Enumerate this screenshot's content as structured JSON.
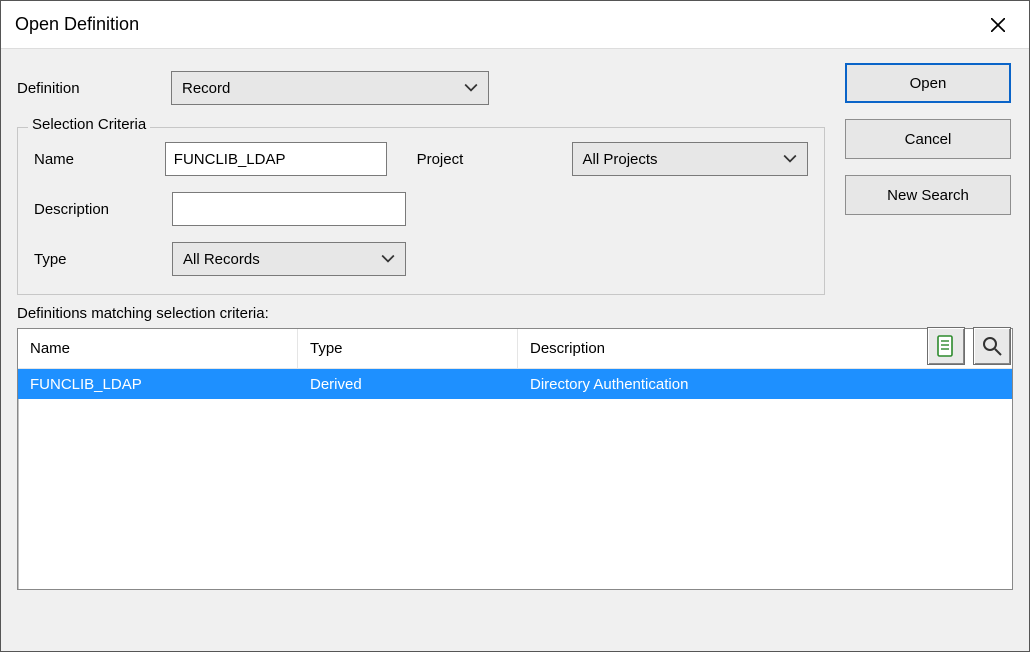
{
  "dialog": {
    "title": "Open Definition"
  },
  "definition": {
    "label": "Definition",
    "value": "Record"
  },
  "selection_criteria": {
    "legend": "Selection Criteria",
    "name": {
      "label": "Name",
      "value": "FUNCLIB_LDAP"
    },
    "project": {
      "label": "Project",
      "value": "All Projects"
    },
    "description": {
      "label": "Description",
      "value": ""
    },
    "type": {
      "label": "Type",
      "value": "All Records"
    }
  },
  "buttons": {
    "open": "Open",
    "cancel": "Cancel",
    "new_search": "New Search"
  },
  "results": {
    "label": "Definitions matching selection criteria:",
    "columns": {
      "name": "Name",
      "type": "Type",
      "description": "Description"
    },
    "rows": [
      {
        "name": "FUNCLIB_LDAP",
        "type": "Derived",
        "description": "Directory Authentication"
      }
    ]
  }
}
